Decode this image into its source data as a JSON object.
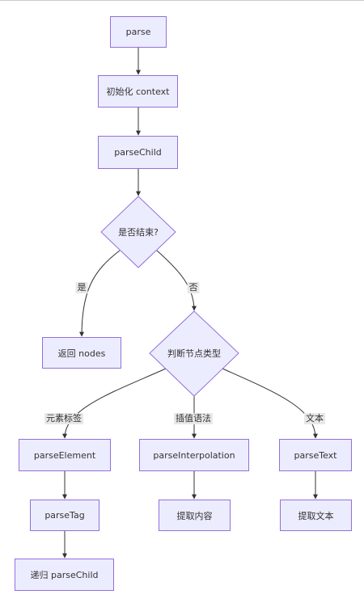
{
  "colors": {
    "node_fill": "#ECECFF",
    "node_stroke": "#9370DB",
    "edge": "#333333",
    "text": "#333333",
    "edge_label_bg": "#e8e8e8"
  },
  "nodes": {
    "parse": "parse",
    "init_context": "初始化 context",
    "parse_child": "parseChild",
    "is_end": "是否结束?",
    "return_nodes": "返回 nodes",
    "judge_type": "判断节点类型",
    "parse_element": "parseElement",
    "parse_interpolation": "parseInterpolation",
    "parse_text": "parseText",
    "parse_tag": "parseTag",
    "extract_content": "提取内容",
    "extract_text": "提取文本",
    "recursive_parse_child": "递归 parseChild"
  },
  "edge_labels": {
    "yes": "是",
    "no": "否",
    "element_tag": "元素标签",
    "interpolation_syntax": "插值语法",
    "text": "文本"
  }
}
